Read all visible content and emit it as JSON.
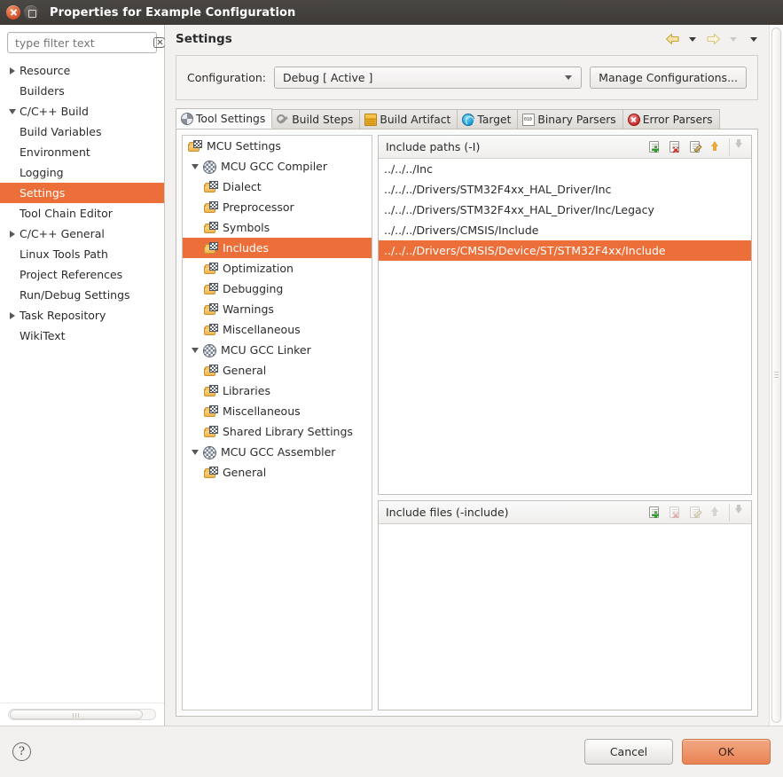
{
  "window": {
    "title": "Properties for Example Configuration",
    "close_label": "Close",
    "maximize_label": "Maximize"
  },
  "filter": {
    "placeholder": "type filter text",
    "value": "",
    "clear_label": "Clear"
  },
  "nav_tree": [
    {
      "label": "Resource",
      "twisty": "closed",
      "indent": 0,
      "selected": false
    },
    {
      "label": "Builders",
      "twisty": "none",
      "indent": 0,
      "selected": false
    },
    {
      "label": "C/C++ Build",
      "twisty": "open",
      "indent": 0,
      "selected": false
    },
    {
      "label": "Build Variables",
      "twisty": "none",
      "indent": 1,
      "selected": false
    },
    {
      "label": "Environment",
      "twisty": "none",
      "indent": 1,
      "selected": false
    },
    {
      "label": "Logging",
      "twisty": "none",
      "indent": 1,
      "selected": false
    },
    {
      "label": "Settings",
      "twisty": "none",
      "indent": 1,
      "selected": true
    },
    {
      "label": "Tool Chain Editor",
      "twisty": "none",
      "indent": 1,
      "selected": false
    },
    {
      "label": "C/C++ General",
      "twisty": "closed",
      "indent": 0,
      "selected": false
    },
    {
      "label": "Linux Tools Path",
      "twisty": "none",
      "indent": 0,
      "selected": false
    },
    {
      "label": "Project References",
      "twisty": "none",
      "indent": 0,
      "selected": false
    },
    {
      "label": "Run/Debug Settings",
      "twisty": "none",
      "indent": 0,
      "selected": false
    },
    {
      "label": "Task Repository",
      "twisty": "closed",
      "indent": 0,
      "selected": false
    },
    {
      "label": "WikiText",
      "twisty": "none",
      "indent": 0,
      "selected": false
    }
  ],
  "page": {
    "title": "Settings",
    "nav_back_label": "Back",
    "nav_back_menu_label": "Back history",
    "nav_forward_label": "Forward",
    "nav_forward_menu_label": "Forward history",
    "nav_menu_label": "View menu"
  },
  "configuration": {
    "label": "Configuration:",
    "selected": "Debug  [ Active ]",
    "manage_button": "Manage Configurations..."
  },
  "tabs": [
    {
      "label": "Tool Settings",
      "icon": "tool-settings-icon",
      "active": true
    },
    {
      "label": "Build Steps",
      "icon": "wrench-icon",
      "active": false
    },
    {
      "label": "Build Artifact",
      "icon": "artifact-icon",
      "active": false
    },
    {
      "label": "Target",
      "icon": "target-globe-icon",
      "active": false
    },
    {
      "label": "Binary Parsers",
      "icon": "binary-doc-icon",
      "active": false
    },
    {
      "label": "Error Parsers",
      "icon": "error-circle-icon",
      "active": false
    }
  ],
  "tool_tree": [
    {
      "label": "MCU Settings",
      "icon": "folder-flag-icon",
      "twisty": "none",
      "indent": 0,
      "selected": false
    },
    {
      "label": "MCU GCC Compiler",
      "icon": "sphere-icon",
      "twisty": "open",
      "indent": 0,
      "selected": false
    },
    {
      "label": "Dialect",
      "icon": "folder-flag-icon",
      "twisty": "none",
      "indent": 1,
      "selected": false
    },
    {
      "label": "Preprocessor",
      "icon": "folder-flag-icon",
      "twisty": "none",
      "indent": 1,
      "selected": false
    },
    {
      "label": "Symbols",
      "icon": "folder-flag-icon",
      "twisty": "none",
      "indent": 1,
      "selected": false
    },
    {
      "label": "Includes",
      "icon": "folder-flag-icon",
      "twisty": "none",
      "indent": 1,
      "selected": true
    },
    {
      "label": "Optimization",
      "icon": "folder-flag-icon",
      "twisty": "none",
      "indent": 1,
      "selected": false
    },
    {
      "label": "Debugging",
      "icon": "folder-flag-icon",
      "twisty": "none",
      "indent": 1,
      "selected": false
    },
    {
      "label": "Warnings",
      "icon": "folder-flag-icon",
      "twisty": "none",
      "indent": 1,
      "selected": false
    },
    {
      "label": "Miscellaneous",
      "icon": "folder-flag-icon",
      "twisty": "none",
      "indent": 1,
      "selected": false
    },
    {
      "label": "MCU GCC Linker",
      "icon": "sphere-icon",
      "twisty": "open",
      "indent": 0,
      "selected": false
    },
    {
      "label": "General",
      "icon": "folder-flag-icon",
      "twisty": "none",
      "indent": 1,
      "selected": false
    },
    {
      "label": "Libraries",
      "icon": "folder-flag-icon",
      "twisty": "none",
      "indent": 1,
      "selected": false
    },
    {
      "label": "Miscellaneous",
      "icon": "folder-flag-icon",
      "twisty": "none",
      "indent": 1,
      "selected": false
    },
    {
      "label": "Shared Library Settings",
      "icon": "folder-flag-icon",
      "twisty": "none",
      "indent": 1,
      "selected": false
    },
    {
      "label": "MCU GCC Assembler",
      "icon": "sphere-icon",
      "twisty": "open",
      "indent": 0,
      "selected": false
    },
    {
      "label": "General",
      "icon": "folder-flag-icon",
      "twisty": "none",
      "indent": 1,
      "selected": false
    }
  ],
  "include_paths": {
    "title": "Include paths (-I)",
    "tools": [
      {
        "name": "add-path-button",
        "icon": "add-doc-icon",
        "enabled": true
      },
      {
        "name": "delete-path-button",
        "icon": "delete-doc-icon",
        "enabled": true
      },
      {
        "name": "edit-path-button",
        "icon": "edit-doc-icon",
        "enabled": true
      },
      {
        "name": "move-path-up-button",
        "icon": "arrow-up-icon",
        "enabled": true
      },
      {
        "name": "move-path-down-button",
        "icon": "arrow-down-icon",
        "enabled": false
      }
    ],
    "items": [
      {
        "path": "../../../Inc",
        "selected": false
      },
      {
        "path": "../../../Drivers/STM32F4xx_HAL_Driver/Inc",
        "selected": false
      },
      {
        "path": "../../../Drivers/STM32F4xx_HAL_Driver/Inc/Legacy",
        "selected": false
      },
      {
        "path": "../../../Drivers/CMSIS/Include",
        "selected": false
      },
      {
        "path": "../../../Drivers/CMSIS/Device/ST/STM32F4xx/Include",
        "selected": true
      }
    ]
  },
  "include_files": {
    "title": "Include files (-include)",
    "tools": [
      {
        "name": "add-file-button",
        "icon": "add-doc-icon",
        "enabled": true
      },
      {
        "name": "delete-file-button",
        "icon": "delete-doc-icon",
        "enabled": false
      },
      {
        "name": "edit-file-button",
        "icon": "edit-doc-icon",
        "enabled": false
      },
      {
        "name": "move-file-up-button",
        "icon": "arrow-up-icon",
        "enabled": false
      },
      {
        "name": "move-file-down-button",
        "icon": "arrow-down-icon",
        "enabled": false
      }
    ],
    "items": []
  },
  "footer": {
    "help_label": "?",
    "cancel_label": "Cancel",
    "ok_label": "OK"
  },
  "colors": {
    "selection_orange": "#ec6f39",
    "ok_button_orange": "#ea8355",
    "titlebar_dark": "#3c3936"
  }
}
